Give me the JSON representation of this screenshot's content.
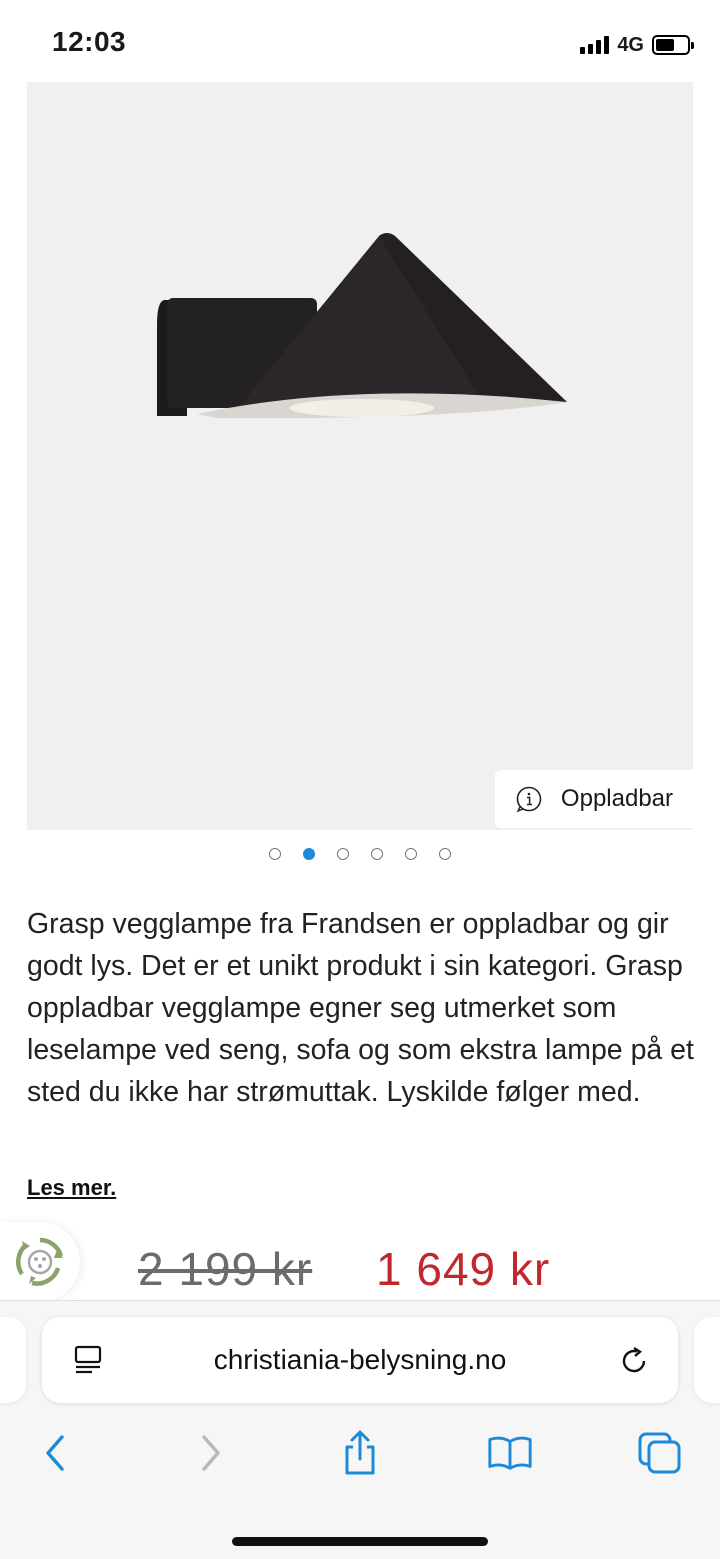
{
  "status_bar": {
    "time": "12:03",
    "network": "4G",
    "battery_level": 0.6
  },
  "product": {
    "badge_label": "Oppladbar",
    "image_count": 6,
    "active_image_index": 1,
    "description": "Grasp vegglampe fra Frandsen er oppladbar og gir godt lys. Det er et unikt produkt i sin kategori. Grasp oppladbar vegglampe egner seg utmerket som leselampe ved seng, sofa og som ekstra lampe på et sted du ikke har strømuttak. Lyskilde følger med.",
    "read_more": "Les mer.",
    "price_old": "2 199 kr",
    "price_new": "1 649 kr"
  },
  "browser": {
    "url": "christiania-belysning.no"
  },
  "colors": {
    "price_sale": "#c0282e",
    "ios_blue": "#1c8ad6",
    "image_background": "#f1f0f0"
  },
  "icons": {
    "info": "info-icon",
    "recycle": "recycle-icon",
    "reader": "reader-mode-icon",
    "reload": "reload-icon",
    "back": "chevron-left-icon",
    "forward": "chevron-right-icon",
    "share": "share-icon",
    "bookmarks": "book-icon",
    "tabs": "tabs-icon"
  }
}
